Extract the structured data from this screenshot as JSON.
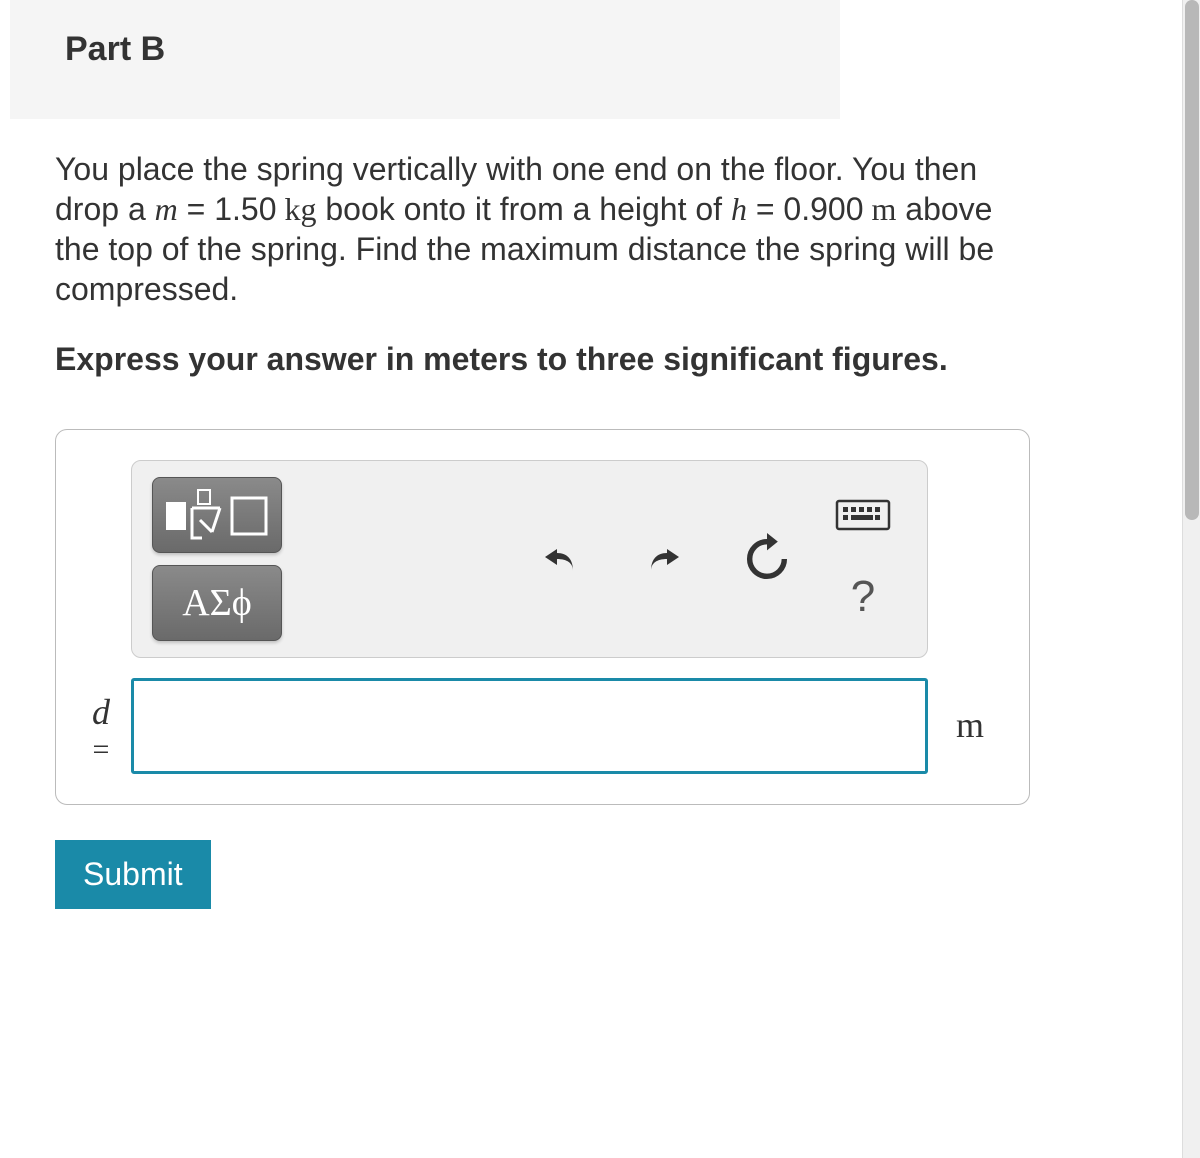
{
  "part": {
    "title": "Part B"
  },
  "question": {
    "text_pre": "You place the spring vertically with one end on the floor. You then drop a ",
    "mass_var": "m",
    "eq1": " = ",
    "mass_val": "1.50",
    "mass_unit": " kg",
    "text_mid1": " book onto it from a height of ",
    "height_var": "h",
    "eq2": " = ",
    "height_val": "0.900",
    "height_unit": " m",
    "text_post": " above the top of the spring. Find the maximum distance the spring will be compressed."
  },
  "instruction": "Express your answer in meters to three significant figures.",
  "answer": {
    "variable": "d",
    "equals": "=",
    "value": "",
    "unit": "m"
  },
  "toolbar": {
    "symbols_label": "ΑΣϕ",
    "help_label": "?"
  },
  "submit_label": "Submit"
}
